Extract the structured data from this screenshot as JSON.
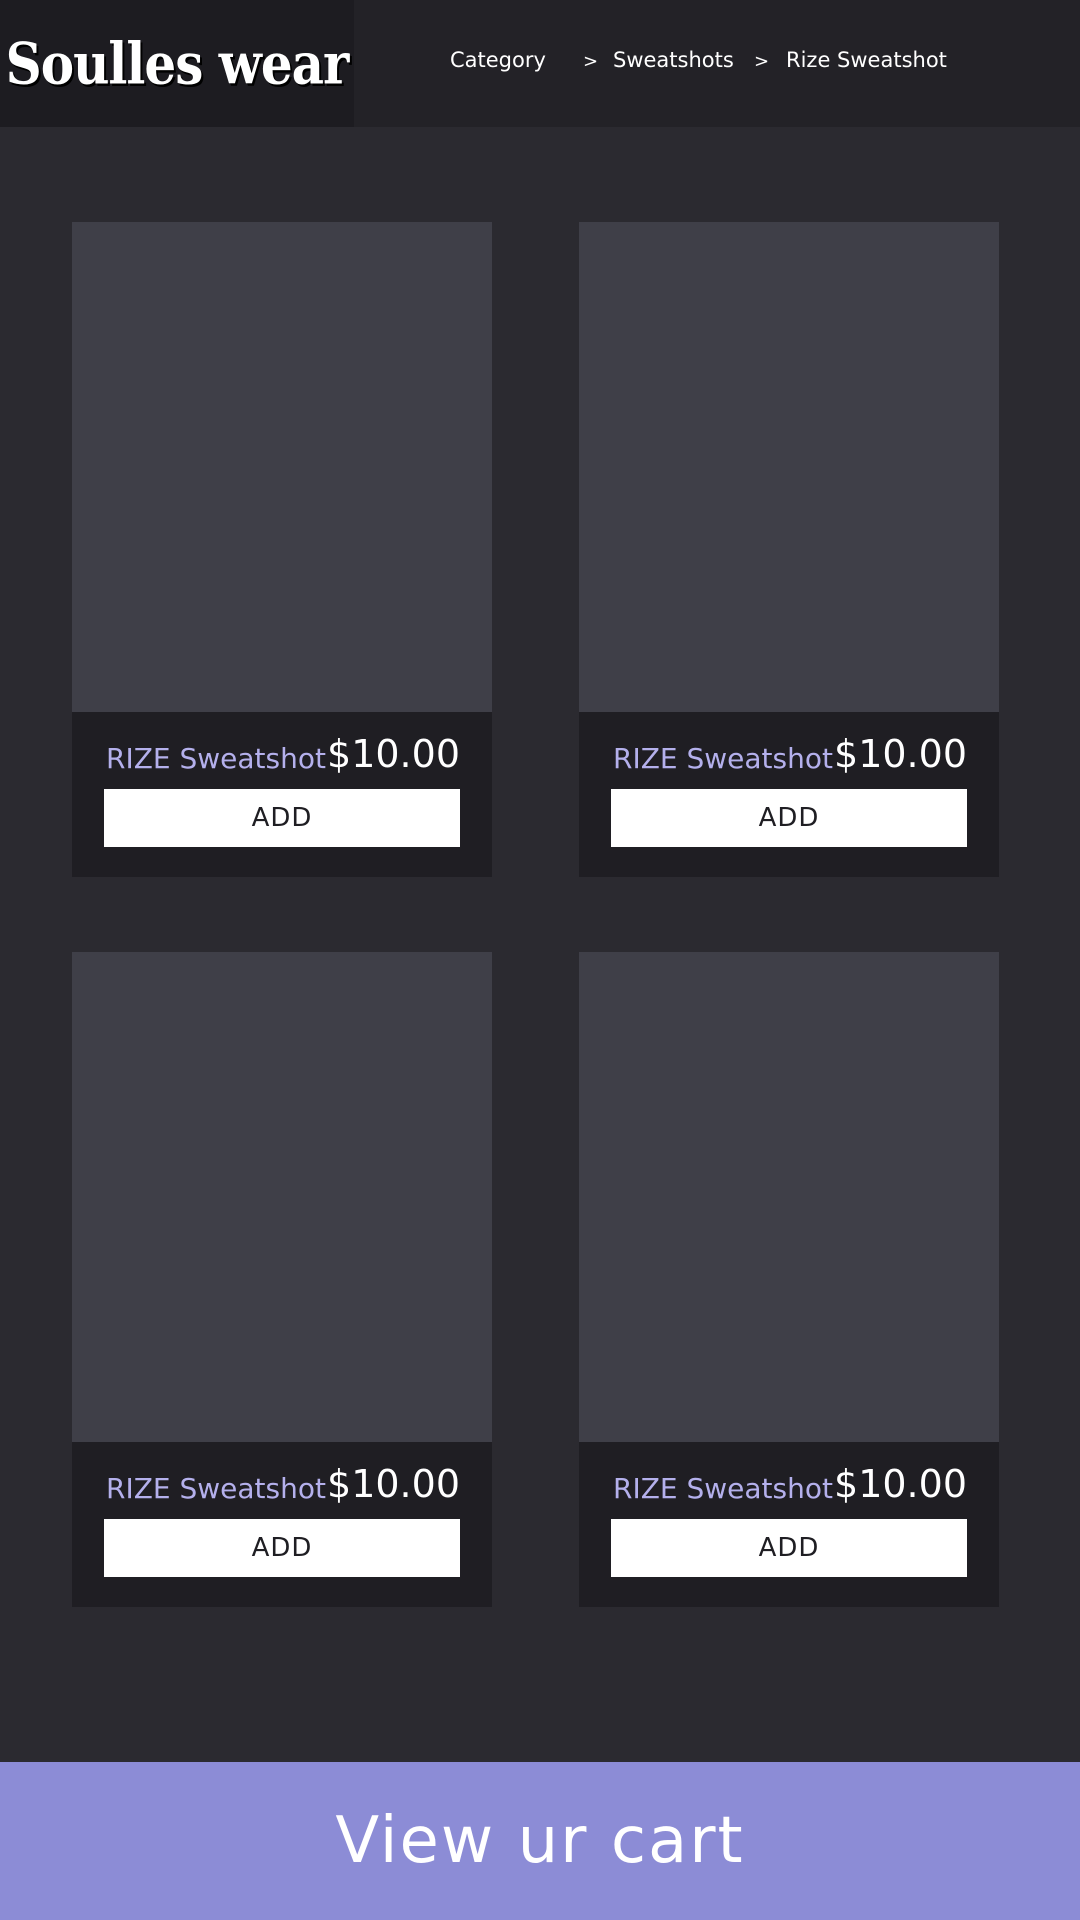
{
  "header": {
    "logo": "Soulles wear",
    "breadcrumb": {
      "items": [
        "Category",
        "Sweatshots",
        "Rize Sweatshot"
      ],
      "separator": ">"
    }
  },
  "products": [
    {
      "name": "RIZE Sweatshot",
      "price": "$10.00",
      "add_label": "ADD"
    },
    {
      "name": "RIZE Sweatshot",
      "price": "$10.00",
      "add_label": "ADD"
    },
    {
      "name": "RIZE Sweatshot",
      "price": "$10.00",
      "add_label": "ADD"
    },
    {
      "name": "RIZE Sweatshot",
      "price": "$10.00",
      "add_label": "ADD"
    }
  ],
  "cart": {
    "label": "View ur cart"
  },
  "colors": {
    "background": "#2b2a30",
    "header": "#232227",
    "logo_box": "#1d1c21",
    "card": "#1f1e23",
    "image_placeholder": "#3f3f48",
    "product_name": "#b4b0ec",
    "cart_bar": "#8c8cd6"
  }
}
